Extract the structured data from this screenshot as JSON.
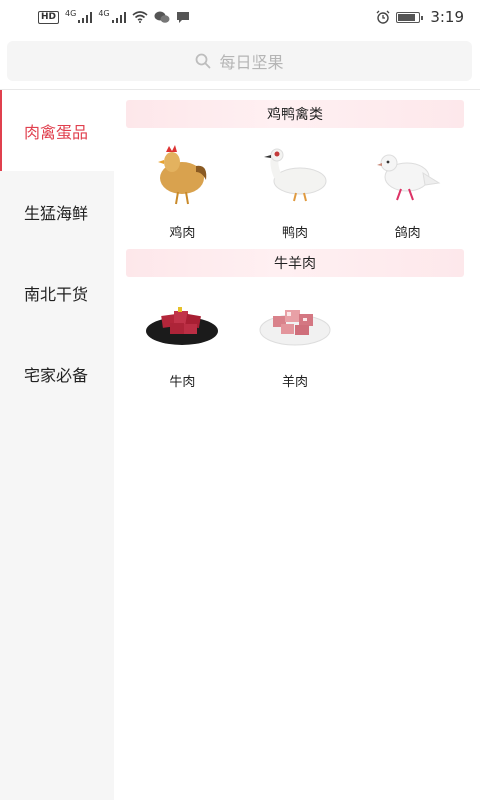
{
  "status_bar": {
    "hd": "HD",
    "net1": "4G",
    "net2": "4G",
    "time": "3:19",
    "battery_level": 0.85
  },
  "search": {
    "placeholder": "每日坚果"
  },
  "sidebar": {
    "items": [
      {
        "label": "肉禽蛋品",
        "active": true
      },
      {
        "label": "生猛海鲜",
        "active": false
      },
      {
        "label": "南北干货",
        "active": false
      },
      {
        "label": "宅家必备",
        "active": false
      }
    ]
  },
  "sections": [
    {
      "title": "鸡鸭禽类",
      "items": [
        {
          "label": "鸡肉",
          "icon": "chicken-image"
        },
        {
          "label": "鸭肉",
          "icon": "duck-image"
        },
        {
          "label": "鸽肉",
          "icon": "pigeon-image"
        }
      ]
    },
    {
      "title": "牛羊肉",
      "items": [
        {
          "label": "牛肉",
          "icon": "beef-image"
        },
        {
          "label": "羊肉",
          "icon": "mutton-image"
        }
      ]
    }
  ],
  "colors": {
    "accent": "#e0404e",
    "sidebar_bg": "#f6f6f6",
    "header_bg": "#fde7ea"
  }
}
